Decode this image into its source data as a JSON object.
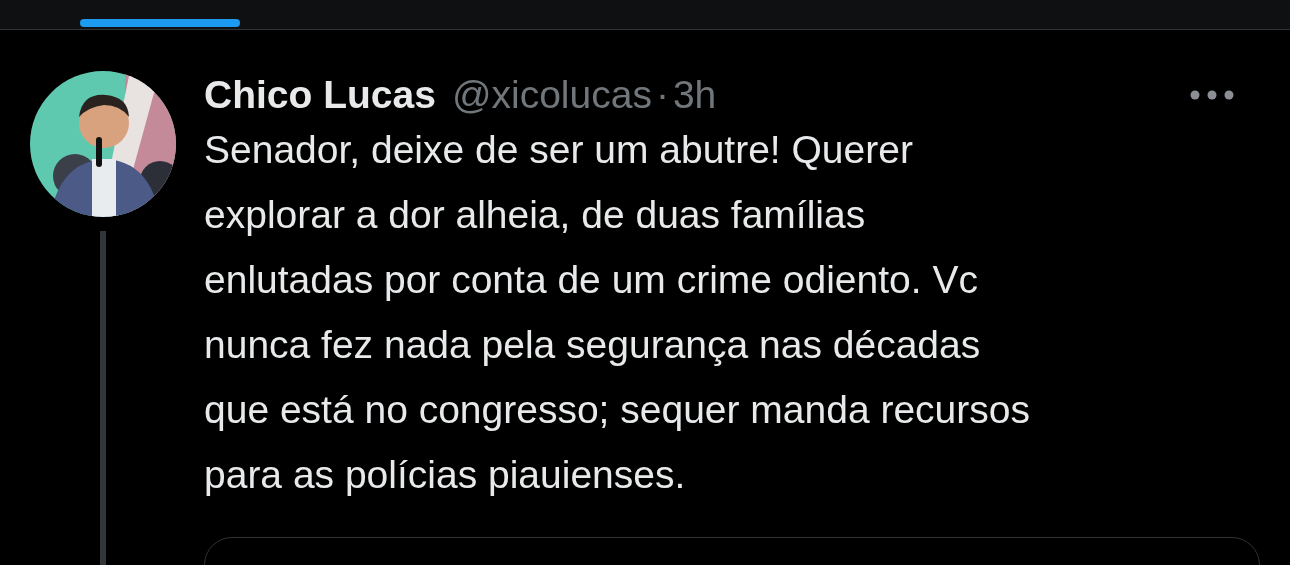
{
  "tabs": [
    {
      "selected": true
    }
  ],
  "tweet": {
    "author": "Chico Lucas",
    "handle": "@xicolucas",
    "separator": "·",
    "time": "3h",
    "thread": true,
    "text": "Senador, deixe de ser um abutre! Querer\nexplorar a dor alheia, de duas famílias\nenlutadas por conta de um crime odiento. Vc\nnunca fez nada pela segurança nas décadas\nque está no congresso; sequer manda recursos\npara as polícias piauienses.",
    "quoted": true
  }
}
